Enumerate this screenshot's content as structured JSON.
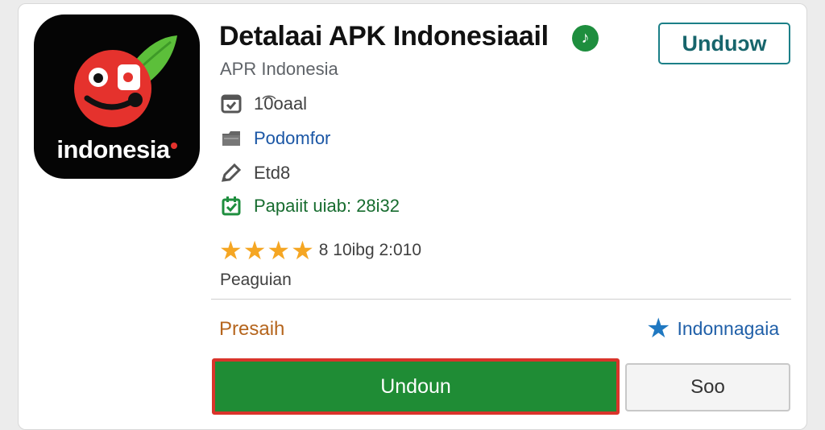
{
  "app": {
    "icon_word": "indonesia",
    "title": "Detalaai APK Indonesiaail",
    "verified_glyph": "♪",
    "publisher": "APR Indonesia"
  },
  "header": {
    "top_button_label": "Unduↄw"
  },
  "meta": [
    {
      "icon": "checkbox-icon",
      "text": "1͡0oaal"
    },
    {
      "icon": "folder-icon",
      "text": "Podomfor"
    },
    {
      "icon": "pencil-icon",
      "text": "Etd8"
    },
    {
      "icon": "calendar-check-icon",
      "text": "Papaiit uiab: 28i32"
    }
  ],
  "rating": {
    "stars": 4,
    "text": "8 10ibg 2:010"
  },
  "category": "Peaguian",
  "price": "Presaih",
  "wishlist_label": "Indonnagaia",
  "buttons": {
    "primary": "Undoun",
    "secondary": "Soo"
  },
  "colors": {
    "primary_green": "#1f8c35",
    "highlight_red": "#d9342b",
    "teal": "#1b7f87",
    "star": "#f5a623",
    "link_blue": "#1a56a5"
  }
}
